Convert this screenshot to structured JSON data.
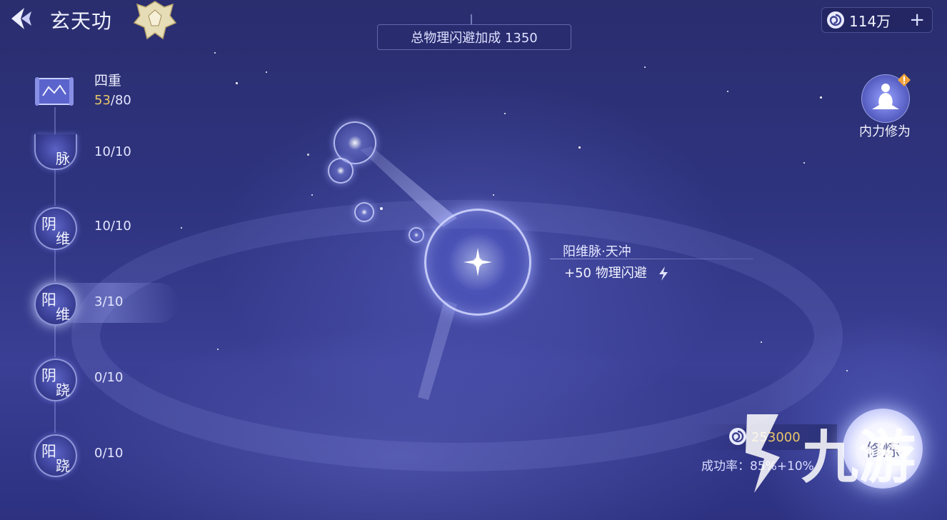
{
  "header": {
    "title": "玄天功",
    "bonus_banner": "总物理闪避加成 1350",
    "currency_amount": "114万",
    "currency_add": "+"
  },
  "level_card": {
    "name": "四重",
    "progress_current": "53",
    "progress_total": "/80"
  },
  "meridians": [
    {
      "char1": "",
      "char2": "脉",
      "progress": "10/10"
    },
    {
      "char1": "阴",
      "char2": "维",
      "progress": "10/10"
    },
    {
      "char1": "阳",
      "char2": "维",
      "progress": "3/10"
    },
    {
      "char1": "阴",
      "char2": "跷",
      "progress": "0/10"
    },
    {
      "char1": "阳",
      "char2": "跷",
      "progress": "0/10"
    }
  ],
  "node": {
    "name": "阳维脉·天冲",
    "effect": "+50  物理闪避"
  },
  "cultivation": {
    "label": "内力修为"
  },
  "upgrade": {
    "cost": "253000",
    "success_rate": "成功率：85%+10%",
    "button_label": "修炼"
  },
  "watermark": {
    "text": "九游"
  },
  "colors": {
    "background": "#2f3480",
    "accent_gold": "#e8c76a",
    "text": "#e6e8ff"
  }
}
